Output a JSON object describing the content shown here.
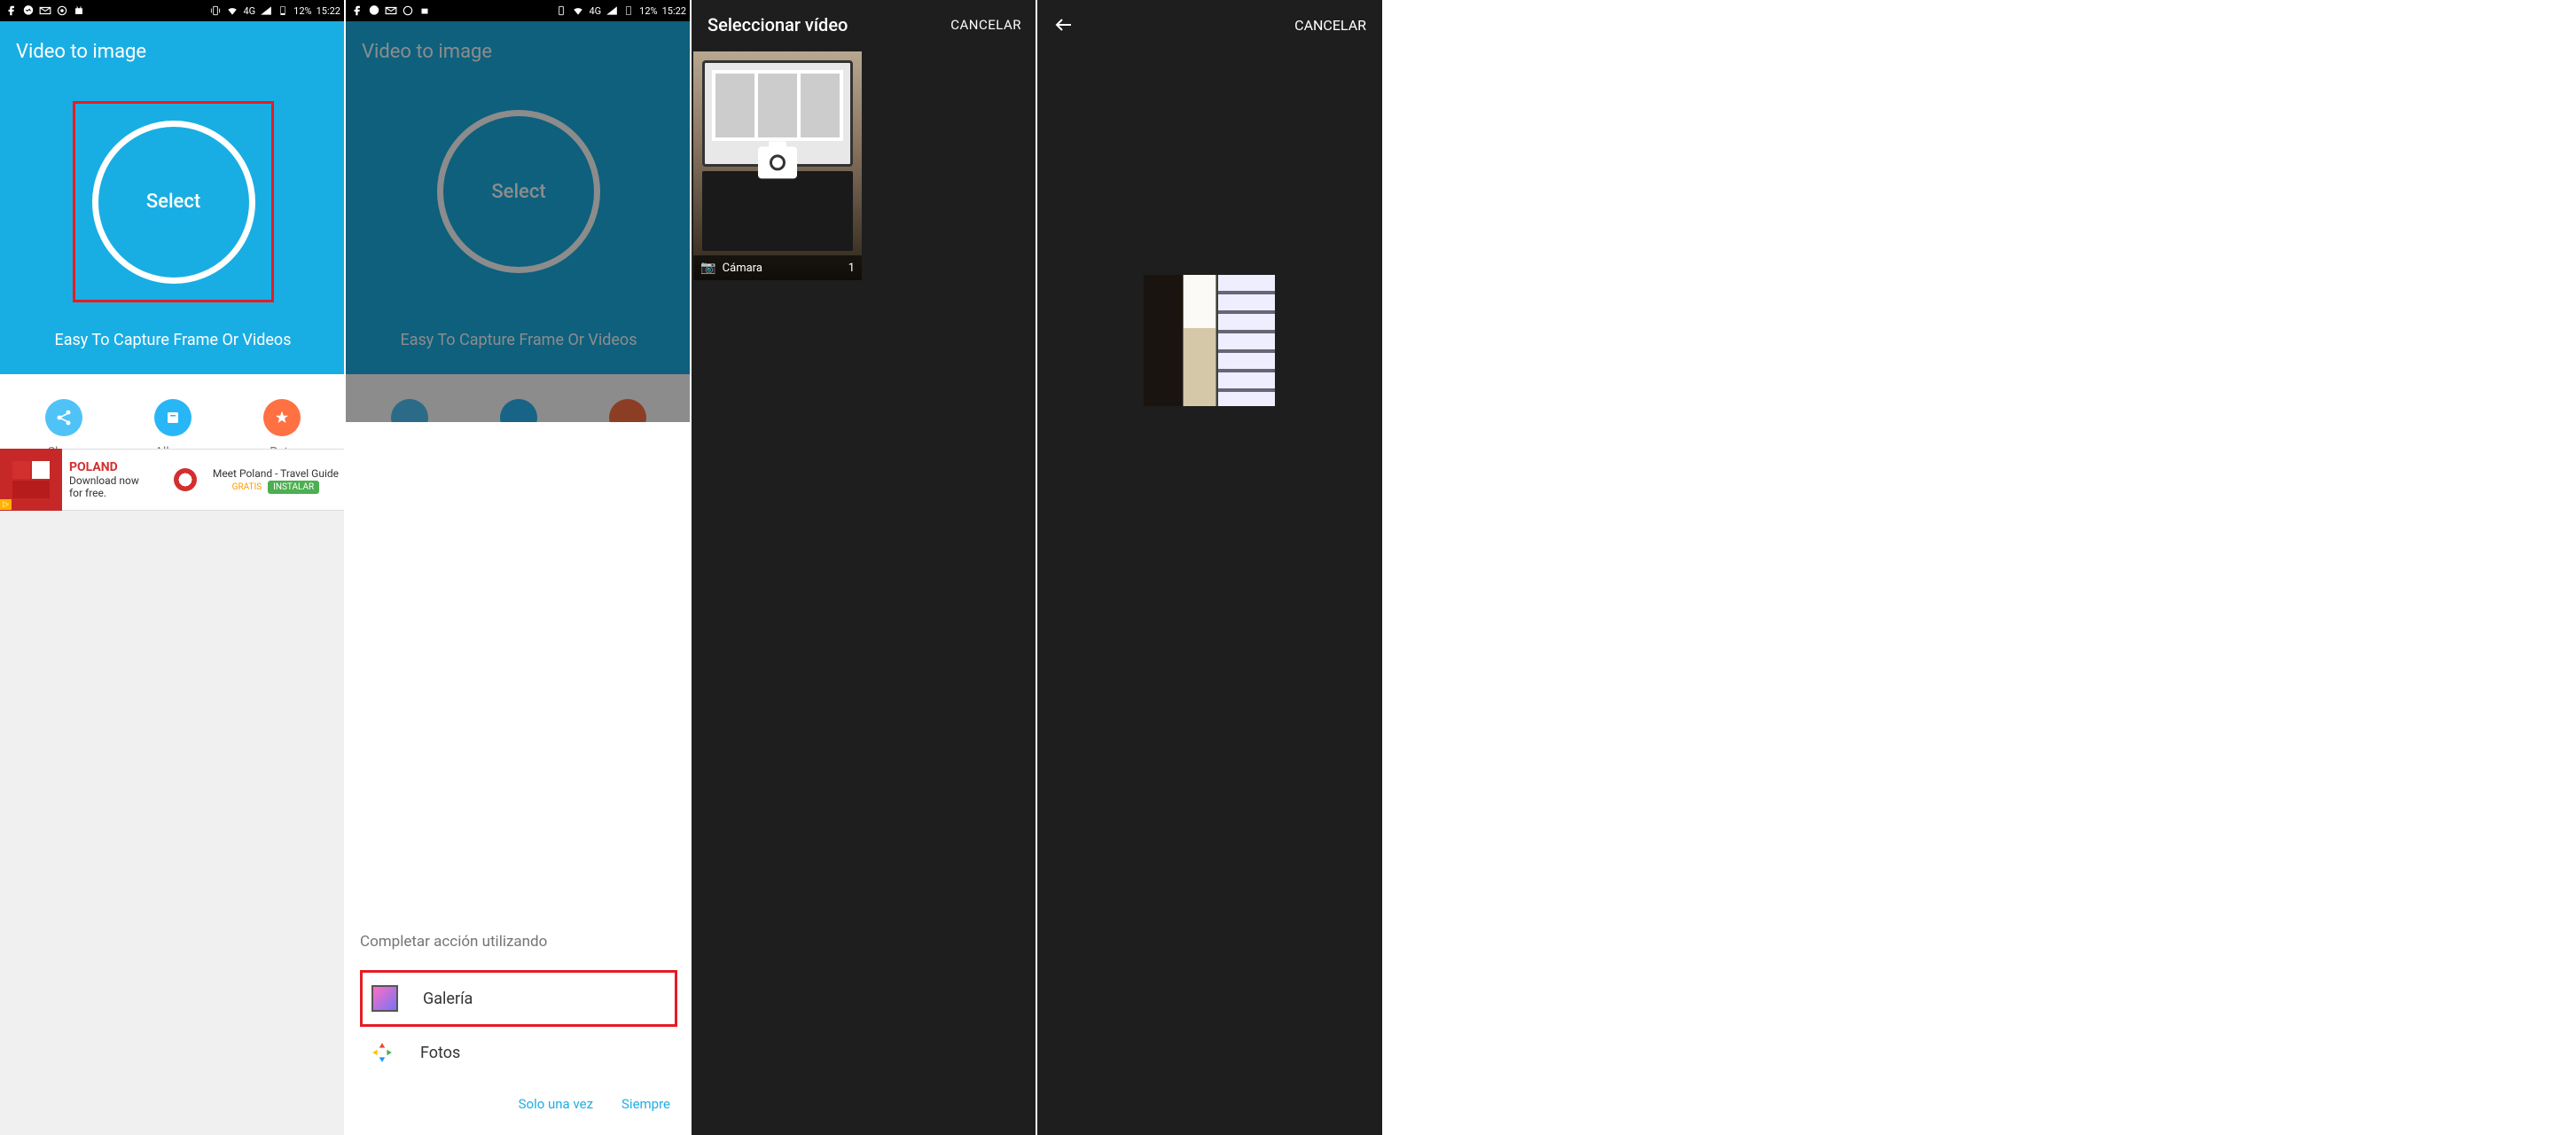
{
  "status": {
    "signal": "4G",
    "battery": "12%",
    "time": "15:22"
  },
  "app": {
    "title": "Video to image",
    "select": "Select",
    "subtitle": "Easy To Capture Frame Or Videos"
  },
  "actions": {
    "share": "Share",
    "album": "Album",
    "rate": "Rate"
  },
  "ad": {
    "brand": "POLAND",
    "line1": "Download now",
    "line2": "for free.",
    "title": "Meet Poland - Travel Guide",
    "gratis": "GRATIS",
    "install": "INSTALAR"
  },
  "chooser": {
    "title": "Completar acción utilizando",
    "galeria": "Galería",
    "fotos": "Fotos",
    "once": "Solo una vez",
    "always": "Siempre"
  },
  "picker": {
    "title": "Seleccionar vídeo",
    "cancel": "CANCELAR",
    "folder": "Cámara",
    "count": "1"
  },
  "detail": {
    "cancel": "CANCELAR"
  }
}
